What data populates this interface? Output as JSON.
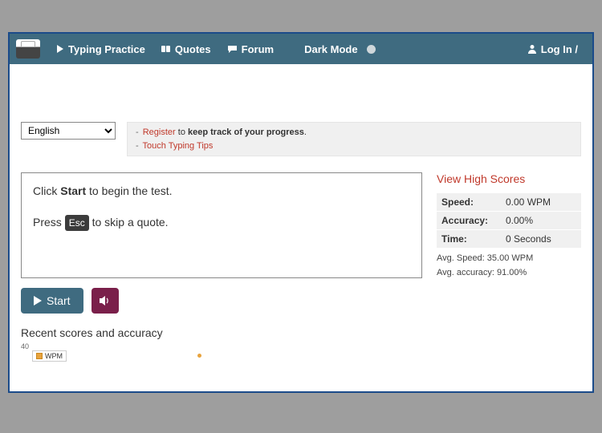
{
  "nav": {
    "typing_practice": "Typing Practice",
    "quotes": "Quotes",
    "forum": "Forum",
    "dark_mode": "Dark Mode",
    "login": "Log In /"
  },
  "lang_selected": "English",
  "tips": {
    "register": "Register",
    "register_tail": " to ",
    "register_bold": "keep track of your progress",
    "touch_typing": "Touch Typing Tips"
  },
  "quote": {
    "line1_prefix": "Click ",
    "line1_bold": "Start",
    "line1_suffix": " to begin the test.",
    "line2_prefix": "Press ",
    "line2_key": "Esc",
    "line2_suffix": " to skip a quote."
  },
  "side": {
    "view_high_scores": "View High Scores",
    "speed_label": "Speed:",
    "speed_value": "0.00 WPM",
    "accuracy_label": "Accuracy:",
    "accuracy_value": "0.00%",
    "time_label": "Time:",
    "time_value": "0 Seconds",
    "avg_speed": "Avg. Speed: 35.00 WPM",
    "avg_accuracy": "Avg. accuracy: 91.00%"
  },
  "buttons": {
    "start": "Start"
  },
  "recent": {
    "title": "Recent scores and accuracy",
    "ymax": "40",
    "legend": "WPM"
  },
  "chart_data": {
    "type": "line",
    "series": [
      {
        "name": "WPM",
        "values": [
          35
        ]
      }
    ],
    "ylim": [
      0,
      40
    ],
    "title": "Recent scores and accuracy"
  }
}
